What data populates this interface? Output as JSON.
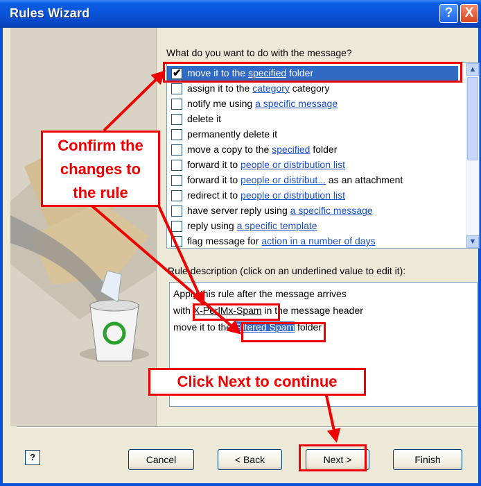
{
  "window": {
    "title": "Rules Wizard",
    "help_label": "?",
    "close_label": "X"
  },
  "actions": {
    "heading": "What do you want to do with the message?",
    "items": [
      {
        "checked": true,
        "pre": "move it to the ",
        "link": "specified",
        "post": " folder"
      },
      {
        "checked": false,
        "pre": "assign it to the ",
        "link": "category",
        "post": " category"
      },
      {
        "checked": false,
        "pre": "notify me using ",
        "link": "a specific message",
        "post": ""
      },
      {
        "checked": false,
        "pre": "delete it",
        "link": "",
        "post": ""
      },
      {
        "checked": false,
        "pre": "permanently delete it",
        "link": "",
        "post": ""
      },
      {
        "checked": false,
        "pre": "move a copy to the ",
        "link": "specified",
        "post": " folder"
      },
      {
        "checked": false,
        "pre": "forward it to ",
        "link": "people or distribution list",
        "post": ""
      },
      {
        "checked": false,
        "pre": "forward it to ",
        "link": "people or distribut...",
        "post": " as an attachment"
      },
      {
        "checked": false,
        "pre": "redirect it to ",
        "link": "people or distribution list",
        "post": ""
      },
      {
        "checked": false,
        "pre": "have server reply using ",
        "link": "a specific message",
        "post": ""
      },
      {
        "checked": false,
        "pre": "reply using ",
        "link": "a specific template",
        "post": ""
      },
      {
        "checked": false,
        "pre": "flag message for ",
        "link": "action in a number of days",
        "post": ""
      }
    ]
  },
  "description": {
    "heading": "Rule description (click on an underlined value to edit it):",
    "line1": "Apply this rule after the message arrives",
    "line2_pre": "with ",
    "line2_link": "X-PerlMx-Spam",
    "line2_post": " in the message header",
    "line3_pre": "move it to the ",
    "line3_link": "Filtered Spam",
    "line3_post": " folder"
  },
  "buttons": {
    "help": "?",
    "cancel": "Cancel",
    "back": "< Back",
    "next": "Next >",
    "finish": "Finish"
  },
  "annotations": {
    "confirm_line1": "Confirm the",
    "confirm_line2": "changes to",
    "confirm_line3": "the rule",
    "next_note": "Click Next to continue",
    "color": "#e00000"
  }
}
